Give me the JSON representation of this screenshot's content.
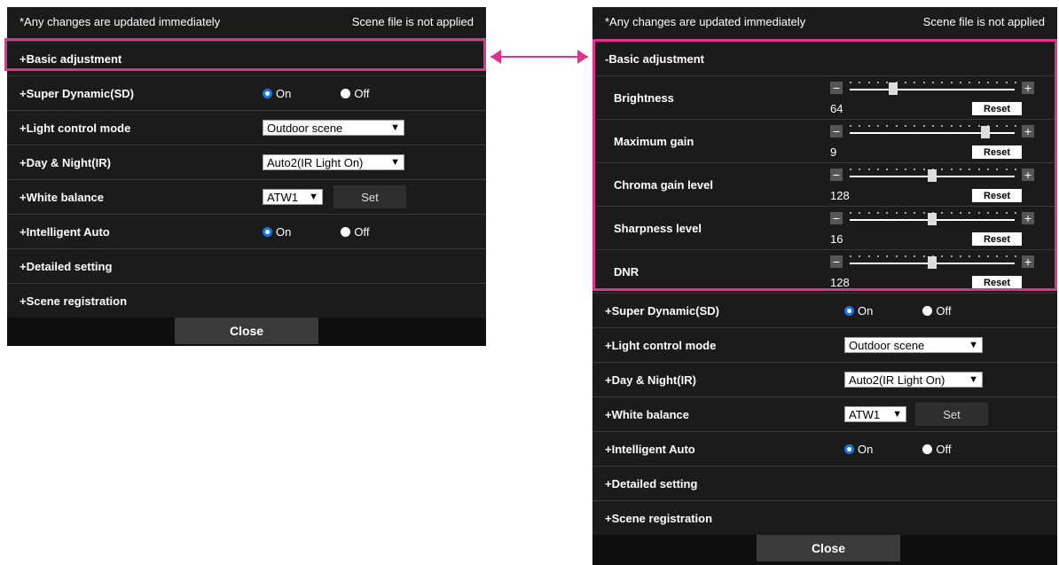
{
  "header": {
    "note": "*Any changes are updated immediately",
    "scene_status": "Scene file is not applied"
  },
  "left": {
    "basic_adjustment": "+Basic adjustment",
    "super_dynamic": {
      "label": "+Super Dynamic(SD)",
      "on": "On",
      "off": "Off",
      "selected": "On"
    },
    "light_control": {
      "label": "+Light control mode",
      "value": "Outdoor scene"
    },
    "day_night": {
      "label": "+Day & Night(IR)",
      "value": "Auto2(IR Light On)"
    },
    "white_balance": {
      "label": "+White balance",
      "value": "ATW1",
      "set_label": "Set"
    },
    "intelligent_auto": {
      "label": "+Intelligent Auto",
      "on": "On",
      "off": "Off",
      "selected": "On"
    },
    "detailed": "+Detailed setting",
    "scene_registration": "+Scene registration",
    "close": "Close"
  },
  "right": {
    "basic_adjustment": "-Basic adjustment",
    "sliders": [
      {
        "label": "Brightness",
        "value": "64",
        "level": 0.25
      },
      {
        "label": "Maximum gain",
        "value": "9",
        "level": 0.84
      },
      {
        "label": "Chroma gain level",
        "value": "128",
        "level": 0.5
      },
      {
        "label": "Sharpness level",
        "value": "16",
        "level": 0.5
      },
      {
        "label": "DNR",
        "value": "128",
        "level": 0.5
      }
    ],
    "reset_label": "Reset",
    "super_dynamic": {
      "label": "+Super Dynamic(SD)",
      "on": "On",
      "off": "Off",
      "selected": "On"
    },
    "light_control": {
      "label": "+Light control mode",
      "value": "Outdoor scene"
    },
    "day_night": {
      "label": "+Day & Night(IR)",
      "value": "Auto2(IR Light On)"
    },
    "white_balance": {
      "label": "+White balance",
      "value": "ATW1",
      "set_label": "Set"
    },
    "intelligent_auto": {
      "label": "+Intelligent Auto",
      "on": "On",
      "off": "Off",
      "selected": "On"
    },
    "detailed": "+Detailed setting",
    "scene_registration": "+Scene registration",
    "close": "Close"
  },
  "colors": {
    "highlight": "#e0338b",
    "radio_selected": "#1a73e8",
    "panel_bg": "#1b1b1b"
  }
}
